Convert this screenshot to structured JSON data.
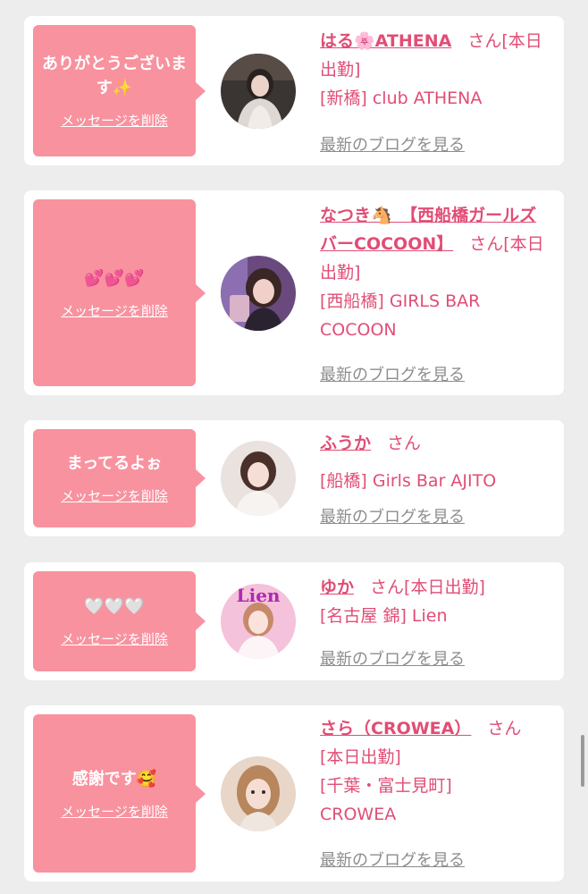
{
  "colors": {
    "accent": "#e14d75",
    "bubble": "#f8929f",
    "blog_link": "#8d8d8d",
    "background": "#ededed"
  },
  "items": [
    {
      "message": "ありがとうございます✨",
      "delete_label": "メッセージを削除",
      "name": "はる🌸ATHENA",
      "honorific": "さん",
      "status": "[本日出勤]",
      "shop": "[新橋] club ATHENA",
      "blog_label": "最新のブログを見る",
      "avatar_icon": "cast-photo-avatar"
    },
    {
      "message": "💕💕💕",
      "delete_label": "メッセージを削除",
      "name": "なつき🐴　【西船橋ガールズバーCOCOON】",
      "honorific": "さん",
      "status": "[本日出勤]",
      "shop": "[西船橋] GIRLS BAR COCOON",
      "blog_label": "最新のブログを見る",
      "avatar_icon": "cast-photo-avatar"
    },
    {
      "message": "まってるよぉ",
      "delete_label": "メッセージを削除",
      "name": "ふうか",
      "honorific": "さん",
      "status": "",
      "shop": "[船橋] Girls Bar AJITO",
      "blog_label": "最新のブログを見る",
      "avatar_icon": "cast-photo-avatar"
    },
    {
      "message": "🤍🤍🤍",
      "delete_label": "メッセージを削除",
      "name": "ゆか",
      "honorific": "さん",
      "status": "[本日出勤]",
      "shop": "[名古屋 錦] Lien",
      "blog_label": "最新のブログを見る",
      "avatar_icon": "cast-photo-avatar",
      "avatar_text": "Lien"
    },
    {
      "message": "感謝です🥰",
      "delete_label": "メッセージを削除",
      "name": "さら（CROWEA）",
      "honorific": "さん",
      "status": "[本日出勤]",
      "shop": "[千葉・富士見町] CROWEA",
      "blog_label": "最新のブログを見る",
      "avatar_icon": "cast-photo-avatar"
    }
  ]
}
